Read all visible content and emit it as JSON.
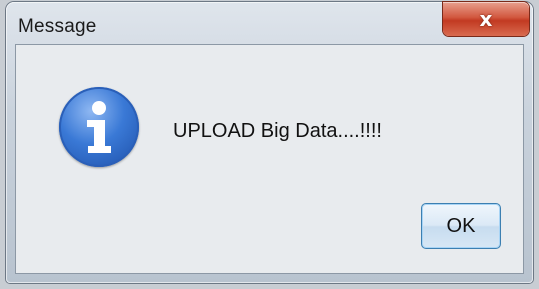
{
  "window": {
    "title": "Message",
    "close_glyph": "x"
  },
  "dialog": {
    "icon": "info-icon",
    "message": "UPLOAD Big Data....!!!!",
    "ok_label": "OK"
  },
  "colors": {
    "close_button": "#c23a22",
    "info_icon": "#3a79d6",
    "ok_border": "#3c7fb1"
  }
}
